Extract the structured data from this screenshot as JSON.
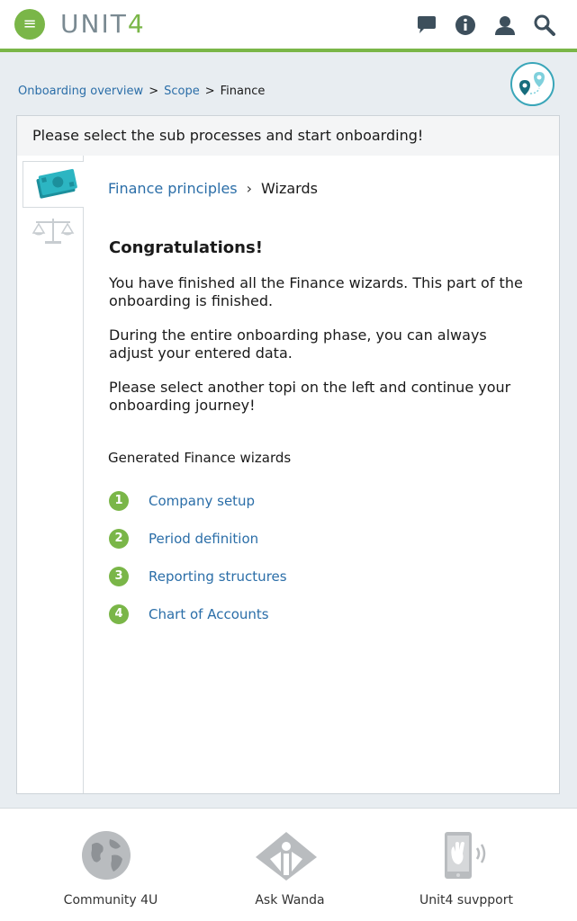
{
  "header": {
    "logo_main": "UNIT",
    "logo_accent": "4",
    "menu_glyph": "≡",
    "icons": [
      "chat-icon",
      "info-icon",
      "user-icon",
      "search-icon"
    ],
    "accent_color": "#7ab648"
  },
  "breadcrumb": {
    "items": [
      {
        "label": "Onboarding overview"
      },
      {
        "label": "Scope"
      },
      {
        "label": "Finance"
      }
    ],
    "separator": ">"
  },
  "panel": {
    "heading": "Please select the sub processes and start onboarding!",
    "side_tabs": [
      {
        "icon": "money-icon",
        "active": true
      },
      {
        "icon": "scale-icon",
        "active": false
      }
    ],
    "crumb": {
      "link": "Finance principles",
      "current": "Wizards"
    },
    "congrats_title": "Congratulations!",
    "paragraphs": [
      "You have finished all the Finance wizards. This part of the onboarding is finished.",
      "During the entire onboarding phase, you can always adjust your entered data.",
      "Please select another topi on the left and continue your onboarding journey!"
    ],
    "generated_title": "Generated Finance wizards",
    "wizards": [
      {
        "num": "1",
        "label": "Company setup"
      },
      {
        "num": "2",
        "label": "Period definition"
      },
      {
        "num": "3",
        "label": "Reporting structures"
      },
      {
        "num": "4",
        "label": "Chart of Accounts"
      }
    ]
  },
  "footer": {
    "items": [
      {
        "label": "Community 4U",
        "icon": "globe-icon"
      },
      {
        "label": "Ask Wanda",
        "icon": "wanda-icon"
      },
      {
        "label": "Unit4 suvpport",
        "icon": "phone-support-icon"
      }
    ]
  }
}
